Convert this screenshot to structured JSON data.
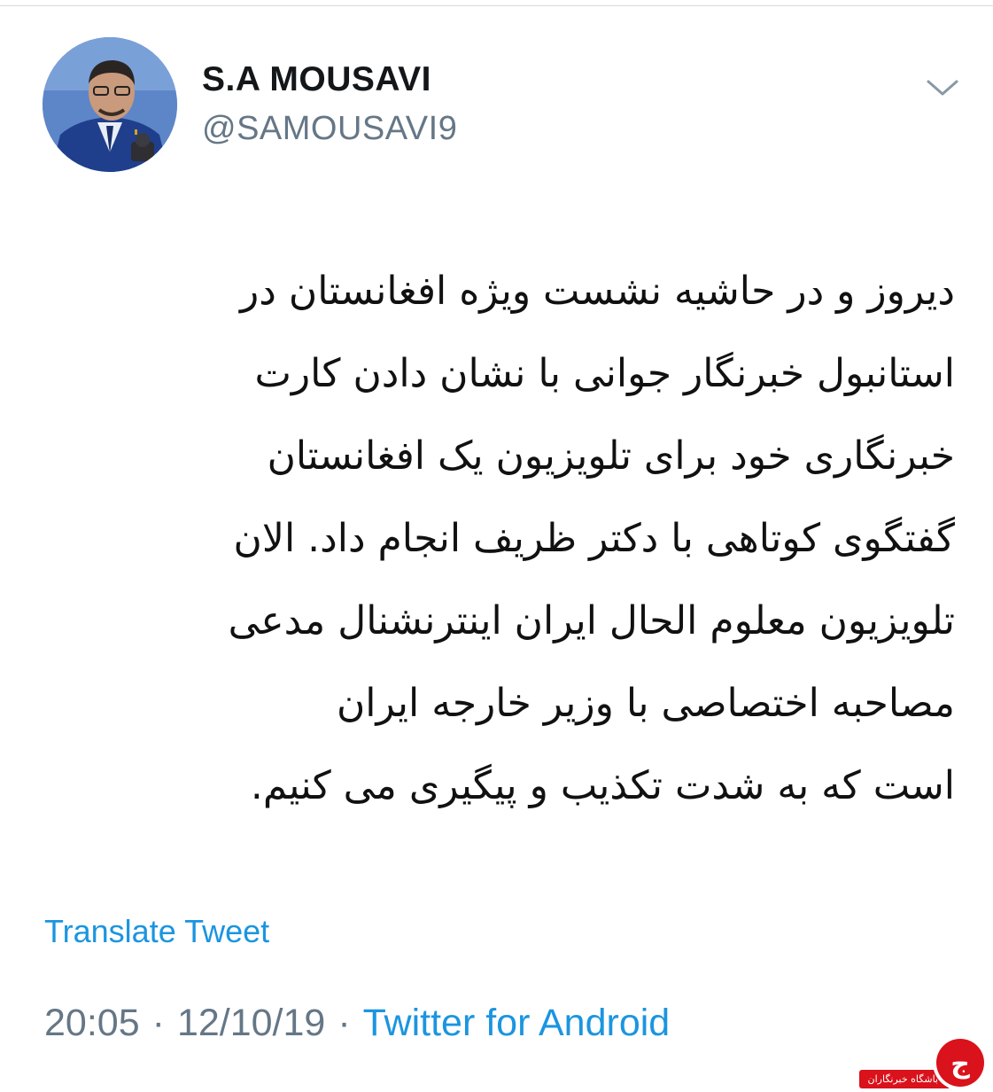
{
  "tweet": {
    "display_name": "S.A MOUSAVI",
    "handle": "@SAMOUSAVI9",
    "text_lines": [
      "دیروز و در حاشیه نشست ویژه افغانستان در",
      "استانبول خبرنگار جوانی با نشان دادن کارت",
      "خبرنگاری خود برای تلویزیون یک افغانستان",
      "گفتگوی کوتاهی با دکتر ظریف انجام داد. الان",
      "تلویزیون معلوم الحال ایران اینترنشنال مدعی",
      "مصاحبه اختصاصی با وزیر خارجه ایران",
      "است که به شدت تکذیب و پیگیری می کنیم."
    ],
    "translate_label": "Translate Tweet",
    "time": "20:05",
    "separator": "·",
    "date": "12/10/19",
    "source": "Twitter for Android"
  },
  "watermark": {
    "label": "باشگاه خبرنگاران",
    "logo_letter": "ج"
  },
  "icons": {
    "caret": "chevron-down-icon"
  },
  "colors": {
    "link": "#1b95e0",
    "secondary_text": "#657786",
    "primary_text": "#14171a",
    "watermark_red": "#d9121b"
  }
}
